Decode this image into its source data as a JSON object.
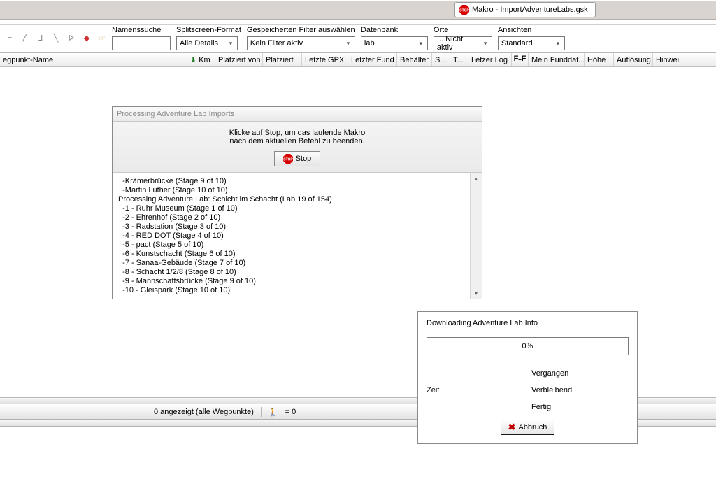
{
  "title_tab": {
    "icon": "stop-icon",
    "text": "Makro - ImportAdventureLabs.gsk"
  },
  "toolbar": {
    "namensuche_label": "Namenssuche",
    "splitscreen_label": "Splitscreen-Format",
    "splitscreen_value": "Alle Details",
    "filter_label": "Gespeicherten Filter auswählen",
    "filter_value": "Kein Filter aktiv",
    "datenbank_label": "Datenbank",
    "datenbank_value": "lab",
    "orte_label": "Orte",
    "orte_value": "... Nicht aktiv",
    "ansichten_label": "Ansichten",
    "ansichten_value": "Standard"
  },
  "columns": [
    "egpunkt-Name",
    "Km",
    "Platziert von",
    "Platziert",
    "Letzte GPX",
    "Letzter Fund",
    "Behälter",
    "S...",
    "T...",
    "Letzer Log",
    "Mein Funddat...",
    "Höhe",
    "Auflösung",
    "Hinwei"
  ],
  "processing_dialog": {
    "title": "Processing Adventure Lab Imports",
    "hint_line1": "Klicke auf Stop, um das laufende Makro",
    "hint_line2": "nach dem aktuellen Befehl zu beenden.",
    "stop_button": "Stop",
    "log_lines": [
      "  -Krämerbrücke (Stage 9 of 10)",
      "  -Martin Luther (Stage 10 of 10)",
      "Processing Adventure Lab: Schicht im Schacht (Lab 19 of 154)",
      "  -1 - Ruhr Museum (Stage 1 of 10)",
      "  -2 - Ehrenhof (Stage 2 of 10)",
      "  -3 - Radstation (Stage 3 of 10)",
      "  -4 - RED DOT (Stage 4 of 10)",
      "  -5 - pact (Stage 5 of 10)",
      "  -6 - Kunstschacht (Stage 6 of 10)",
      "  -7 - Sanaa-Gebäude (Stage 7 of 10)",
      "  -8 - Schacht 1/2/8 (Stage 8 of 10)",
      "  -9 - Mannschaftsbrücke (Stage 9 of 10)",
      "  -10 - Gleispark (Stage 10 of 10)"
    ]
  },
  "download_dialog": {
    "title": "Downloading Adventure Lab Info",
    "progress_text": "0%",
    "zeit_label": "Zeit",
    "vergangen": "Vergangen",
    "verbleibend": "Verbleibend",
    "fertig": "Fertig",
    "abbruch": "Abbruch"
  },
  "statusbar": {
    "count_text": "0 angezeigt (alle Wegpunkte)",
    "person_text": "= 0"
  }
}
